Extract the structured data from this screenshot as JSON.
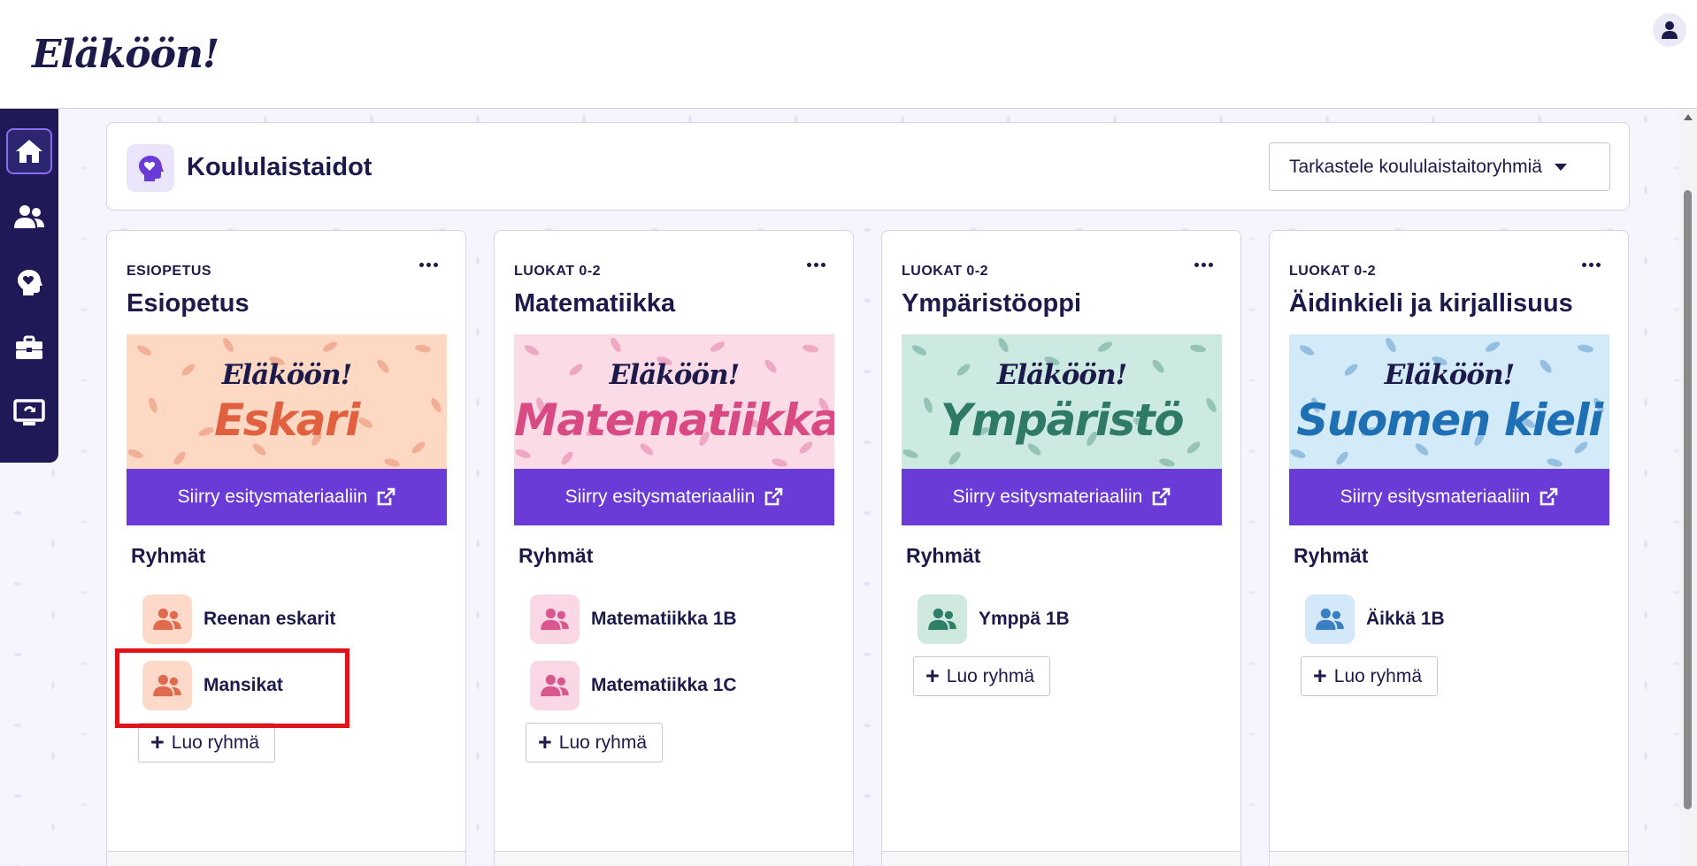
{
  "app": {
    "logo": "Eläköön!"
  },
  "sidebar": {
    "items": [
      {
        "name": "home",
        "active": true
      },
      {
        "name": "groups"
      },
      {
        "name": "skills"
      },
      {
        "name": "tools"
      },
      {
        "name": "presentation"
      }
    ]
  },
  "page": {
    "title": "Koululaistaidot",
    "dropdown_label": "Tarkastele koululaistaitoryhmiä"
  },
  "cards": [
    {
      "category": "ESIOPETUS",
      "title": "Esiopetus",
      "banner_brand": "Eläköön!",
      "banner_subject": "Eskari",
      "banner_bg": "#fdd9c4",
      "banner_color": "#e0603f",
      "present_label": "Siirry esitysmateriaaliin",
      "groups_heading": "Ryhmät",
      "groups": [
        "Reenan eskarit",
        "Mansikat"
      ],
      "group_icon_bg": "#fcd9c9",
      "group_icon_color": "#e06a4e",
      "create_label": "Luo ryhmä"
    },
    {
      "category": "LUOKAT 0-2",
      "title": "Matematiikka",
      "banner_brand": "Eläköön!",
      "banner_subject": "Matematiikka",
      "banner_bg": "#fbdbe6",
      "banner_color": "#d94a85",
      "present_label": "Siirry esitysmateriaaliin",
      "groups_heading": "Ryhmät",
      "groups": [
        "Matematiikka 1B",
        "Matematiikka 1C"
      ],
      "group_icon_bg": "#fad7e4",
      "group_icon_color": "#d9578f",
      "create_label": "Luo ryhmä"
    },
    {
      "category": "LUOKAT 0-2",
      "title": "Ympäristöoppi",
      "banner_brand": "Eläköön!",
      "banner_subject": "Ympäristö",
      "banner_bg": "#cceae2",
      "banner_color": "#2f7a66",
      "present_label": "Siirry esitysmateriaaliin",
      "groups_heading": "Ryhmät",
      "groups": [
        "Ymppä 1B"
      ],
      "group_icon_bg": "#cfe9df",
      "group_icon_color": "#2f7f68",
      "create_label": "Luo ryhmä"
    },
    {
      "category": "LUOKAT 0-2",
      "title": "Äidinkieli ja kirjallisuus",
      "banner_brand": "Eläköön!",
      "banner_subject": "Suomen kieli",
      "banner_bg": "#d3eaf9",
      "banner_color": "#1f6fb5",
      "present_label": "Siirry esitysmateriaaliin",
      "groups_heading": "Ryhmät",
      "groups": [
        "Äikkä 1B"
      ],
      "group_icon_bg": "#d3e8f8",
      "group_icon_color": "#3a7fc2",
      "create_label": "Luo ryhmä"
    }
  ],
  "colors": {
    "primary": "#6a3bd6",
    "navy": "#1c1a4a",
    "sidebar": "#1f1a57",
    "highlight": "#e0151a"
  }
}
